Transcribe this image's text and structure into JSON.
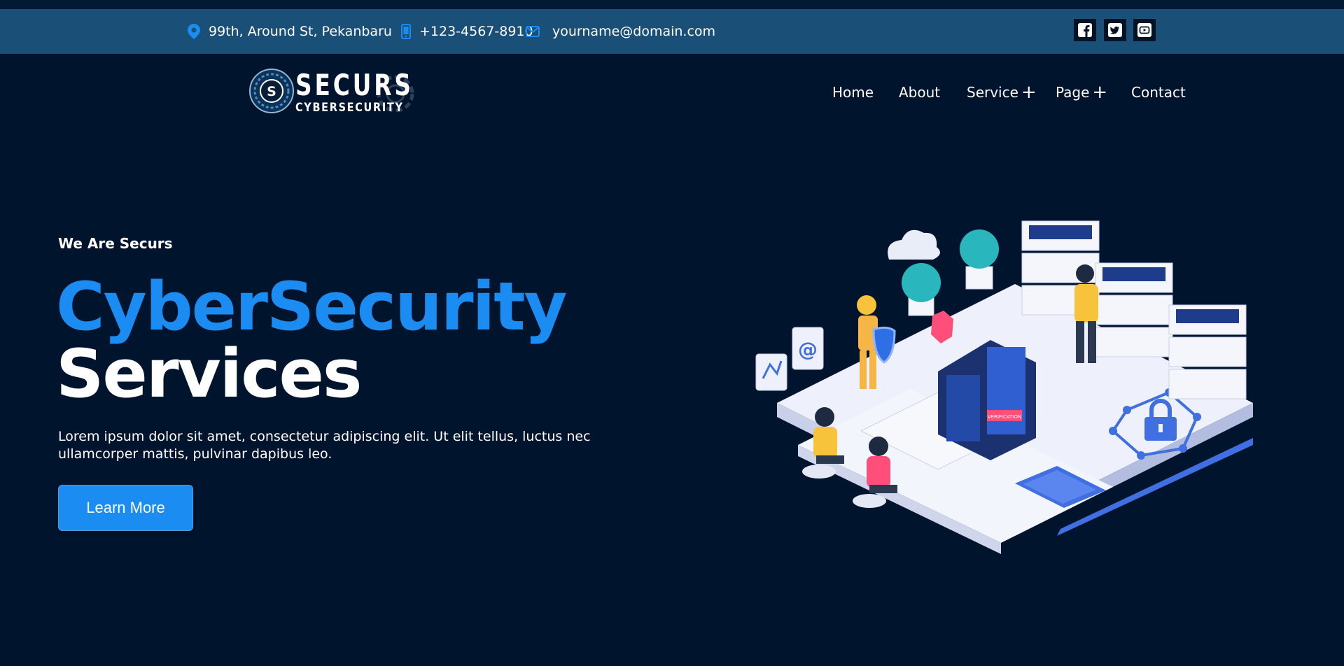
{
  "topbar": {
    "address": "99th, Around St, Pekanbaru",
    "phone": "+123-4567-8910",
    "email": "yourname@domain.com",
    "social": [
      "facebook-icon",
      "twitter-icon",
      "youtube-icon"
    ]
  },
  "logo": {
    "title": "SECURS",
    "subtitle": "CYBERSECURITY",
    "badge_letter": "S"
  },
  "nav": {
    "home": "Home",
    "about": "About",
    "service": "Service",
    "page": "Page",
    "contact": "Contact",
    "plus": "+"
  },
  "hero": {
    "eyebrow": "We Are Securs",
    "title_line1": "CyberSecurity",
    "title_line2": "Services",
    "description": "Lorem ipsum dolor sit amet, consectetur adipiscing elit. Ut elit tellus, luctus nec ullamcorper mattis, pulvinar dapibus leo.",
    "cta": "Learn More",
    "illustration_badge": "VERIFICATION"
  },
  "colors": {
    "background": "#00142e",
    "topbar": "#1a4f78",
    "accent": "#1b8cf2"
  }
}
